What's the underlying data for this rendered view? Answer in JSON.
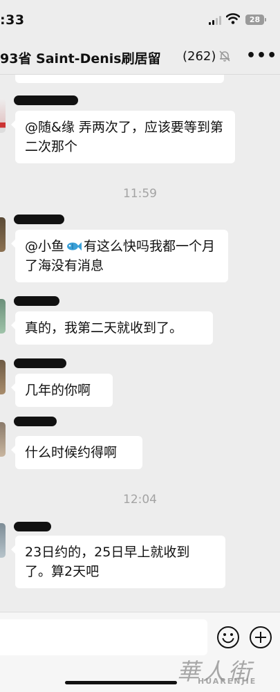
{
  "status_bar": {
    "time": ":33",
    "battery_level": "28"
  },
  "header": {
    "title": "93省 Saint-Denis刷居留",
    "member_count": "(262)",
    "muted": true,
    "more_label": "•••"
  },
  "messages": [
    {
      "type": "text",
      "sender": "redacted",
      "text": "@随&缘 弄两次了，应该要等到第二次那个"
    },
    {
      "type": "time",
      "text": "11:59"
    },
    {
      "type": "text",
      "sender": "redacted",
      "text_before_icon": "@小鱼",
      "icon": "fish-icon",
      "text": "有这么快吗我都一个月了海没有消息"
    },
    {
      "type": "text",
      "sender": "redacted",
      "text": "真的，我第二天就收到了。"
    },
    {
      "type": "text",
      "sender": "redacted",
      "text": "几年的你啊"
    },
    {
      "type": "text",
      "sender": "redacted",
      "text": "什么时候约得啊"
    },
    {
      "type": "time",
      "text": "12:04"
    },
    {
      "type": "text",
      "sender": "redacted",
      "text": "23日约的，25日早上就收到了。算2天吧"
    }
  ],
  "input_bar": {
    "value": "",
    "emoji_icon": "emoji-icon",
    "plus_icon": "plus-icon"
  },
  "watermark": {
    "script_text": "華人街",
    "latin_text": "HUARENJIE"
  },
  "colors": {
    "background": "#ededed",
    "bubble": "#ffffff",
    "timestamp": "#a3a3a3"
  }
}
